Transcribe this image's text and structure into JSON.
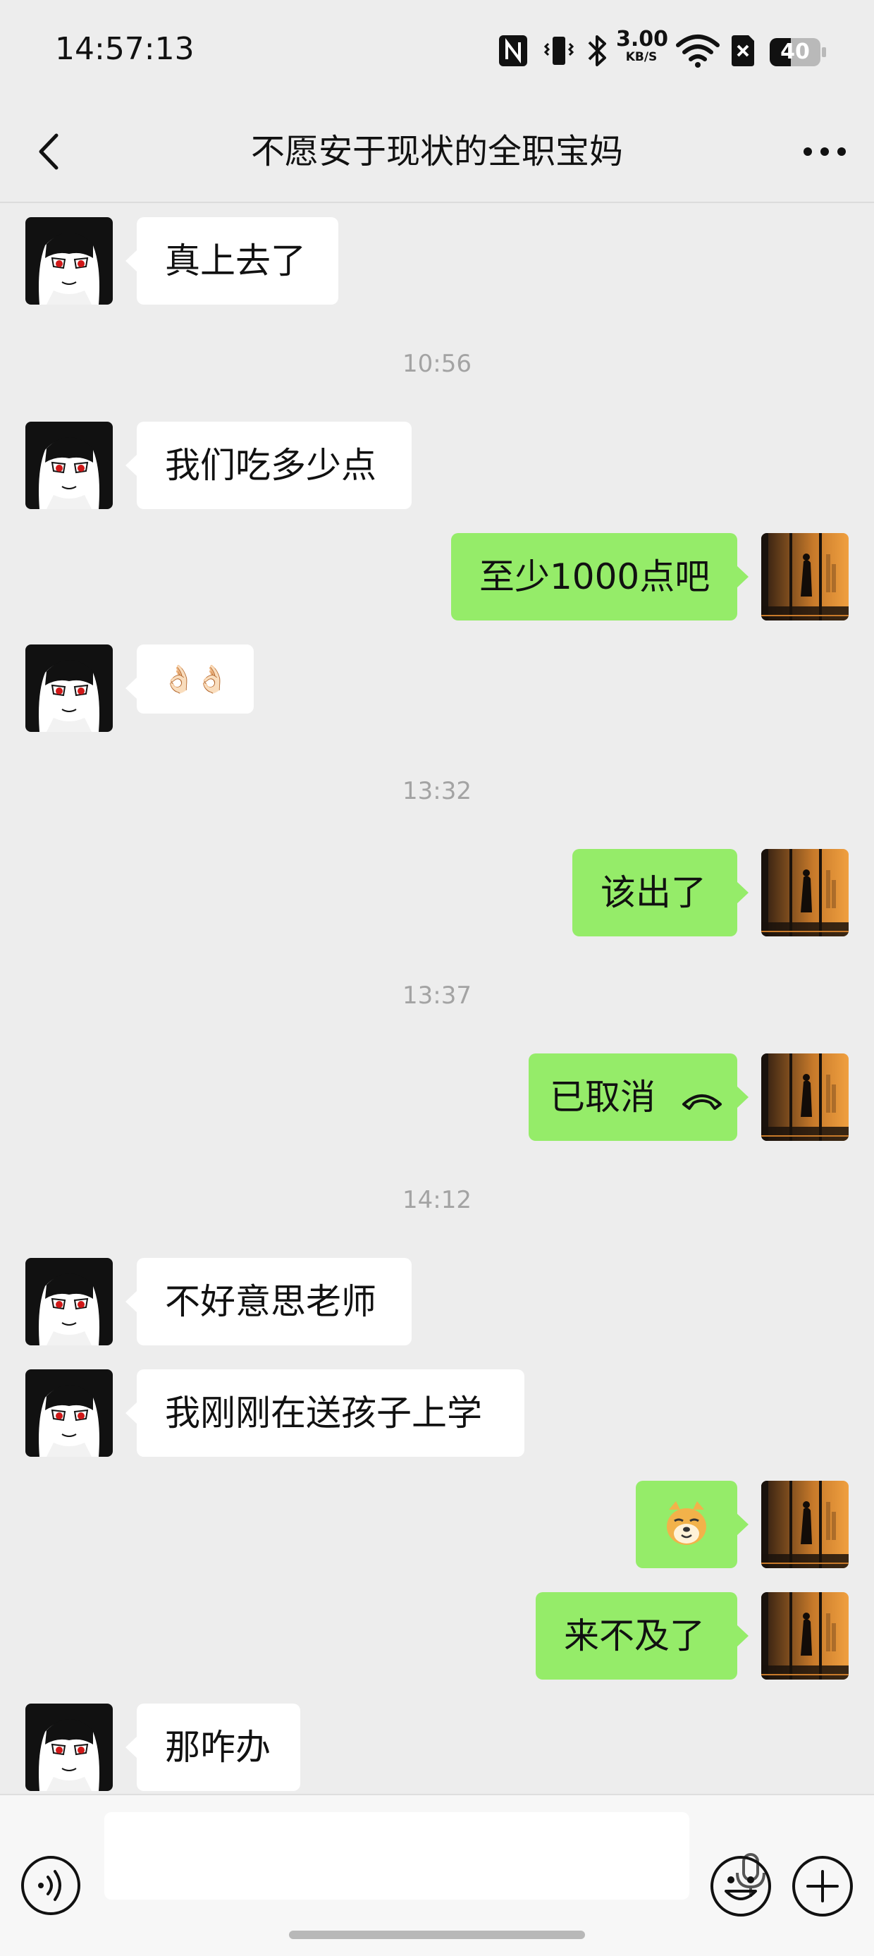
{
  "status": {
    "time": "14:57:13",
    "net_speed_value": "3.00",
    "net_speed_unit": "KB/S",
    "battery": "40"
  },
  "nav": {
    "title": "不愿安于现状的全职宝妈"
  },
  "messages": {
    "m1": "真上去了",
    "t1": "10:56",
    "m2": "我们吃多少点",
    "m3": "至少1000点吧",
    "m4": "👌🏻👌🏻",
    "t2": "13:32",
    "m5": "该出了",
    "t3": "13:37",
    "m6": "已取消",
    "t4": "14:12",
    "m7": "不好意思老师",
    "m8": "我刚刚在送孩子上学",
    "m10": "来不及了",
    "m11": "那咋办"
  },
  "icons": {
    "back": "chevron-left-icon",
    "more": "more-dots-icon",
    "call_cancelled": "phone-hangup-icon",
    "doge_sticker": "doge-emoji",
    "voice": "voice-icon",
    "mic": "mic-icon",
    "emoji": "emoji-icon",
    "plus": "plus-icon"
  },
  "colors": {
    "background": "#ededed",
    "outgoing_bubble": "#95ec69",
    "incoming_bubble": "#ffffff",
    "timestamp": "#a3a3a3"
  }
}
